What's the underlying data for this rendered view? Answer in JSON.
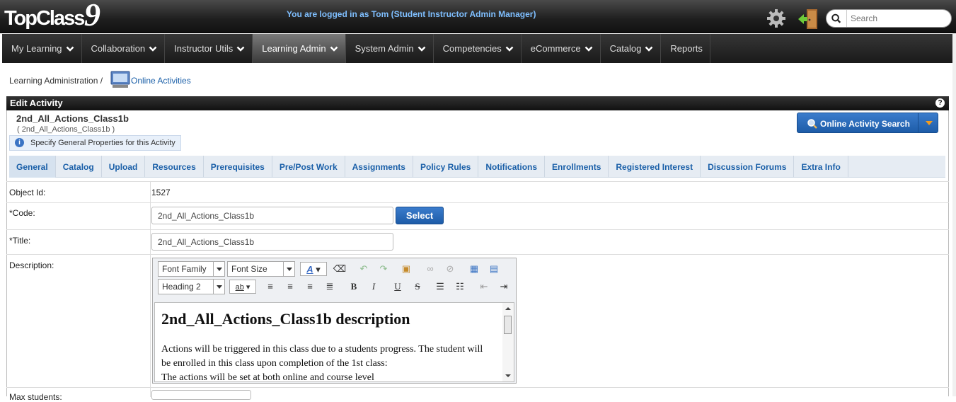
{
  "header": {
    "logo_word": "TopClass",
    "logo_num": "9",
    "logged_in": "You are logged in as Tom (Student Instructor Admin Manager)",
    "search_placeholder": "Search",
    "icons": [
      "gear-icon",
      "logout-door-icon",
      "search-icon"
    ]
  },
  "nav": {
    "items": [
      {
        "label": "My Learning"
      },
      {
        "label": "Collaboration"
      },
      {
        "label": "Instructor Utils"
      },
      {
        "label": "Learning Admin"
      },
      {
        "label": "System Admin"
      },
      {
        "label": "Competencies"
      },
      {
        "label": "eCommerce"
      },
      {
        "label": "Catalog"
      },
      {
        "label": "Reports"
      }
    ],
    "active": "Learning Admin"
  },
  "breadcrumb": {
    "parent": "Learning Administration",
    "separator": "/",
    "current": "Online Activities"
  },
  "panel": {
    "title": "Edit Activity",
    "help": "?",
    "activity_name": "2nd_All_Actions_Class1b",
    "activity_code_sub": "( 2nd_All_Actions_Class1b )",
    "hint": "Specify General Properties for this Activity",
    "search_button": "Online Activity Search"
  },
  "tabs": [
    {
      "label": "General"
    },
    {
      "label": "Catalog"
    },
    {
      "label": "Upload"
    },
    {
      "label": "Resources"
    },
    {
      "label": "Prerequisites"
    },
    {
      "label": "Pre/Post Work"
    },
    {
      "label": "Assignments"
    },
    {
      "label": "Policy Rules"
    },
    {
      "label": "Notifications"
    },
    {
      "label": "Enrollments"
    },
    {
      "label": "Registered Interest"
    },
    {
      "label": "Discussion Forums"
    },
    {
      "label": "Extra Info"
    }
  ],
  "form": {
    "object_id_label": "Object Id:",
    "object_id_value": "1527",
    "code_label": "*Code:",
    "code_value": "2nd_All_Actions_Class1b",
    "select_button": "Select",
    "title_label": "*Title:",
    "title_value": "2nd_All_Actions_Class1b",
    "description_label": "Description:",
    "max_students_label": "Max students:"
  },
  "editor": {
    "font_family": "Font Family",
    "font_size": "Font Size",
    "block_format": "Heading 2",
    "heading": "2nd_All_Actions_Class1b description",
    "body": "Actions will be triggered in this class due to a students progress. The student will be enrolled in this class upon completion of the 1st class:\nThe actions will be set at both online and course level"
  },
  "colors": {
    "accent_blue": "#1d5ca8",
    "link_blue": "#1a5fa8",
    "header_dark": "#1e1e1e",
    "dropdown_orange": "#f29b1d"
  }
}
